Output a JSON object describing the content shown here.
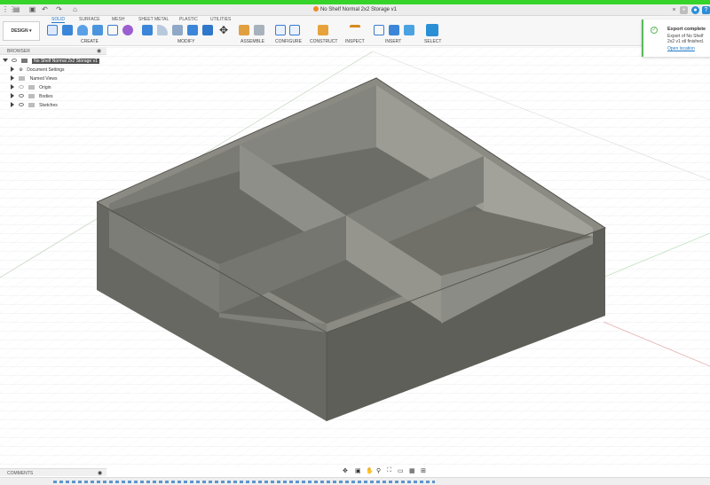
{
  "window": {
    "title": "No Shelf Normal 2x2 Storage v1",
    "accent": "#36d42a"
  },
  "ribbon": {
    "workspace": "DESIGN",
    "tabs": [
      "SOLID",
      "SURFACE",
      "MESH",
      "SHEET METAL",
      "PLASTIC",
      "UTILITIES"
    ],
    "active_tab": "SOLID",
    "groups": [
      "CREATE",
      "MODIFY",
      "ASSEMBLE",
      "CONFIGURE",
      "CONSTRUCT",
      "INSPECT",
      "INSERT",
      "SELECT"
    ]
  },
  "browser": {
    "title": "BROWSER",
    "root": "No Shelf Normal 2x2 Storage v1",
    "items": [
      "Document Settings",
      "Named Views",
      "Origin",
      "Bodies",
      "Sketches"
    ]
  },
  "notification": {
    "title": "Export complete",
    "message": "Export of No Shelf 2x2 v1 stl finished.",
    "link": "Open location"
  },
  "comments": {
    "label": "COMMENTS"
  },
  "colors": {
    "model": "#6c6c66",
    "grid": "#e3e5e8",
    "tab_active": "#1d77c9"
  }
}
